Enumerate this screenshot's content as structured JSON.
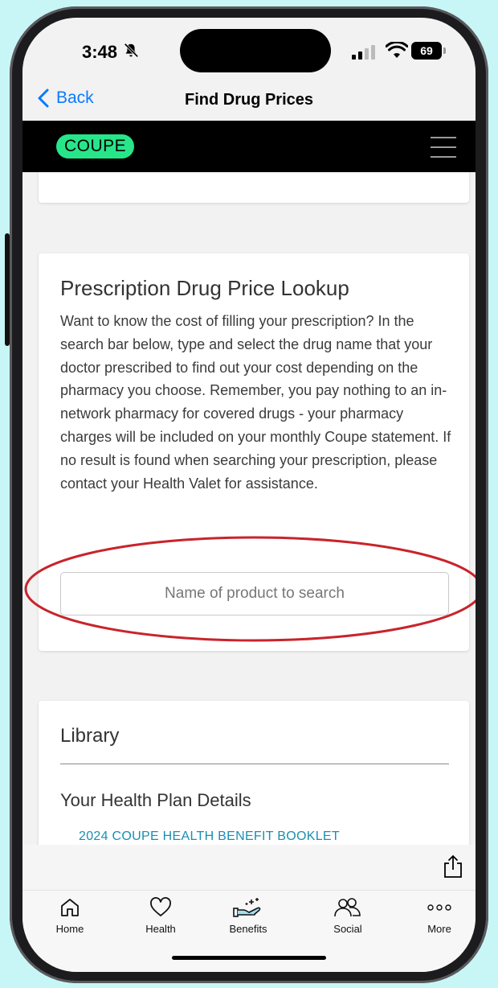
{
  "status_bar": {
    "time": "3:48",
    "battery": "69"
  },
  "header": {
    "back_label": "Back",
    "title": "Find Drug Prices"
  },
  "app_bar": {
    "logo_text": "COUPE"
  },
  "lookup": {
    "title": "Prescription Drug Price Lookup",
    "description": "Want to know the cost of filling your prescription? In the search bar below, type and select the drug name that your doctor prescribed to find out your cost depending on the pharmacy you choose. Remember, you pay nothing to an in-network pharmacy for covered drugs - your pharmacy charges will be included on your monthly Coupe statement. If no result is found when searching your prescription, please contact your Health Valet for assistance.",
    "search_placeholder": "Name of product to search"
  },
  "library": {
    "title": "Library",
    "section_title": "Your Health Plan Details",
    "link": "2024 COUPE HEALTH BENEFIT BOOKLET"
  },
  "tabs": [
    {
      "label": "Home",
      "icon": "home-icon"
    },
    {
      "label": "Health",
      "icon": "heart-icon"
    },
    {
      "label": "Benefits",
      "icon": "benefits-hand-icon"
    },
    {
      "label": "Social",
      "icon": "people-icon"
    },
    {
      "label": "More",
      "icon": "more-dots-icon"
    }
  ],
  "colors": {
    "accent": "#0a7aff",
    "logo_green": "#27e68a",
    "highlight_red": "#c8242b",
    "link": "#1a8fb0"
  }
}
